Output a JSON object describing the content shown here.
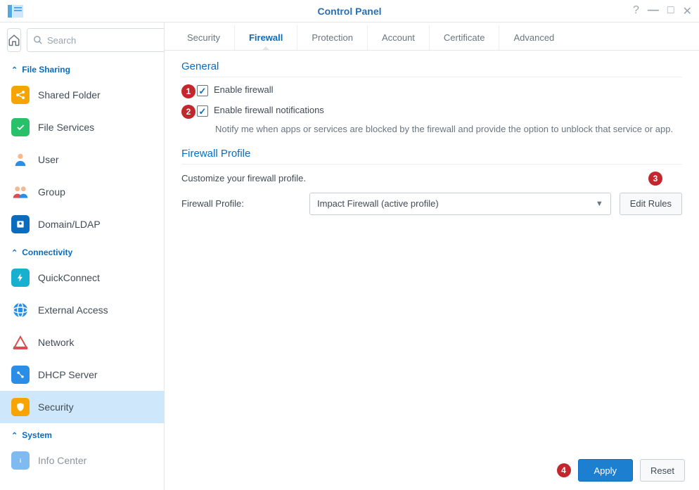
{
  "window": {
    "title": "Control Panel"
  },
  "search": {
    "placeholder": "Search",
    "value": ""
  },
  "sidebar": {
    "sections": [
      {
        "label": "File Sharing",
        "items": [
          {
            "label": "Shared Folder",
            "icon": "shared-folder",
            "color": "#f7a400"
          },
          {
            "label": "File Services",
            "icon": "file-services",
            "color": "#29c06a"
          },
          {
            "label": "User",
            "icon": "user",
            "color": "#f49a5c"
          },
          {
            "label": "Group",
            "icon": "group",
            "color": "#f49a5c"
          },
          {
            "label": "Domain/LDAP",
            "icon": "domain-ldap",
            "color": "#0a6cbf"
          }
        ]
      },
      {
        "label": "Connectivity",
        "items": [
          {
            "label": "QuickConnect",
            "icon": "quickconnect",
            "color": "#17b1cf"
          },
          {
            "label": "External Access",
            "icon": "external-access",
            "color": "#2b8ee6"
          },
          {
            "label": "Network",
            "icon": "network",
            "color": "#d94f4f"
          },
          {
            "label": "DHCP Server",
            "icon": "dhcp",
            "color": "#2b8ee6"
          },
          {
            "label": "Security",
            "icon": "security",
            "color": "#f7a400",
            "selected": true
          }
        ]
      },
      {
        "label": "System",
        "items": [
          {
            "label": "Info Center",
            "icon": "info",
            "color": "#2b8ee6"
          }
        ]
      }
    ]
  },
  "tabs": [
    {
      "label": "Security"
    },
    {
      "label": "Firewall",
      "active": true
    },
    {
      "label": "Protection"
    },
    {
      "label": "Account"
    },
    {
      "label": "Certificate"
    },
    {
      "label": "Advanced"
    }
  ],
  "general": {
    "title": "General",
    "enable_firewall": {
      "label": "Enable firewall",
      "checked": true,
      "badge": "1"
    },
    "enable_notifications": {
      "label": "Enable firewall notifications",
      "checked": true,
      "badge": "2"
    },
    "notify_desc": "Notify me when apps or services are blocked by the firewall and provide the option to unblock that service or app."
  },
  "profile": {
    "title": "Firewall Profile",
    "customize": "Customize your firewall profile.",
    "label": "Firewall Profile:",
    "selected": "Impact Firewall (active profile)",
    "edit_button": "Edit Rules",
    "edit_badge": "3"
  },
  "footer": {
    "apply": "Apply",
    "apply_badge": "4",
    "reset": "Reset"
  }
}
